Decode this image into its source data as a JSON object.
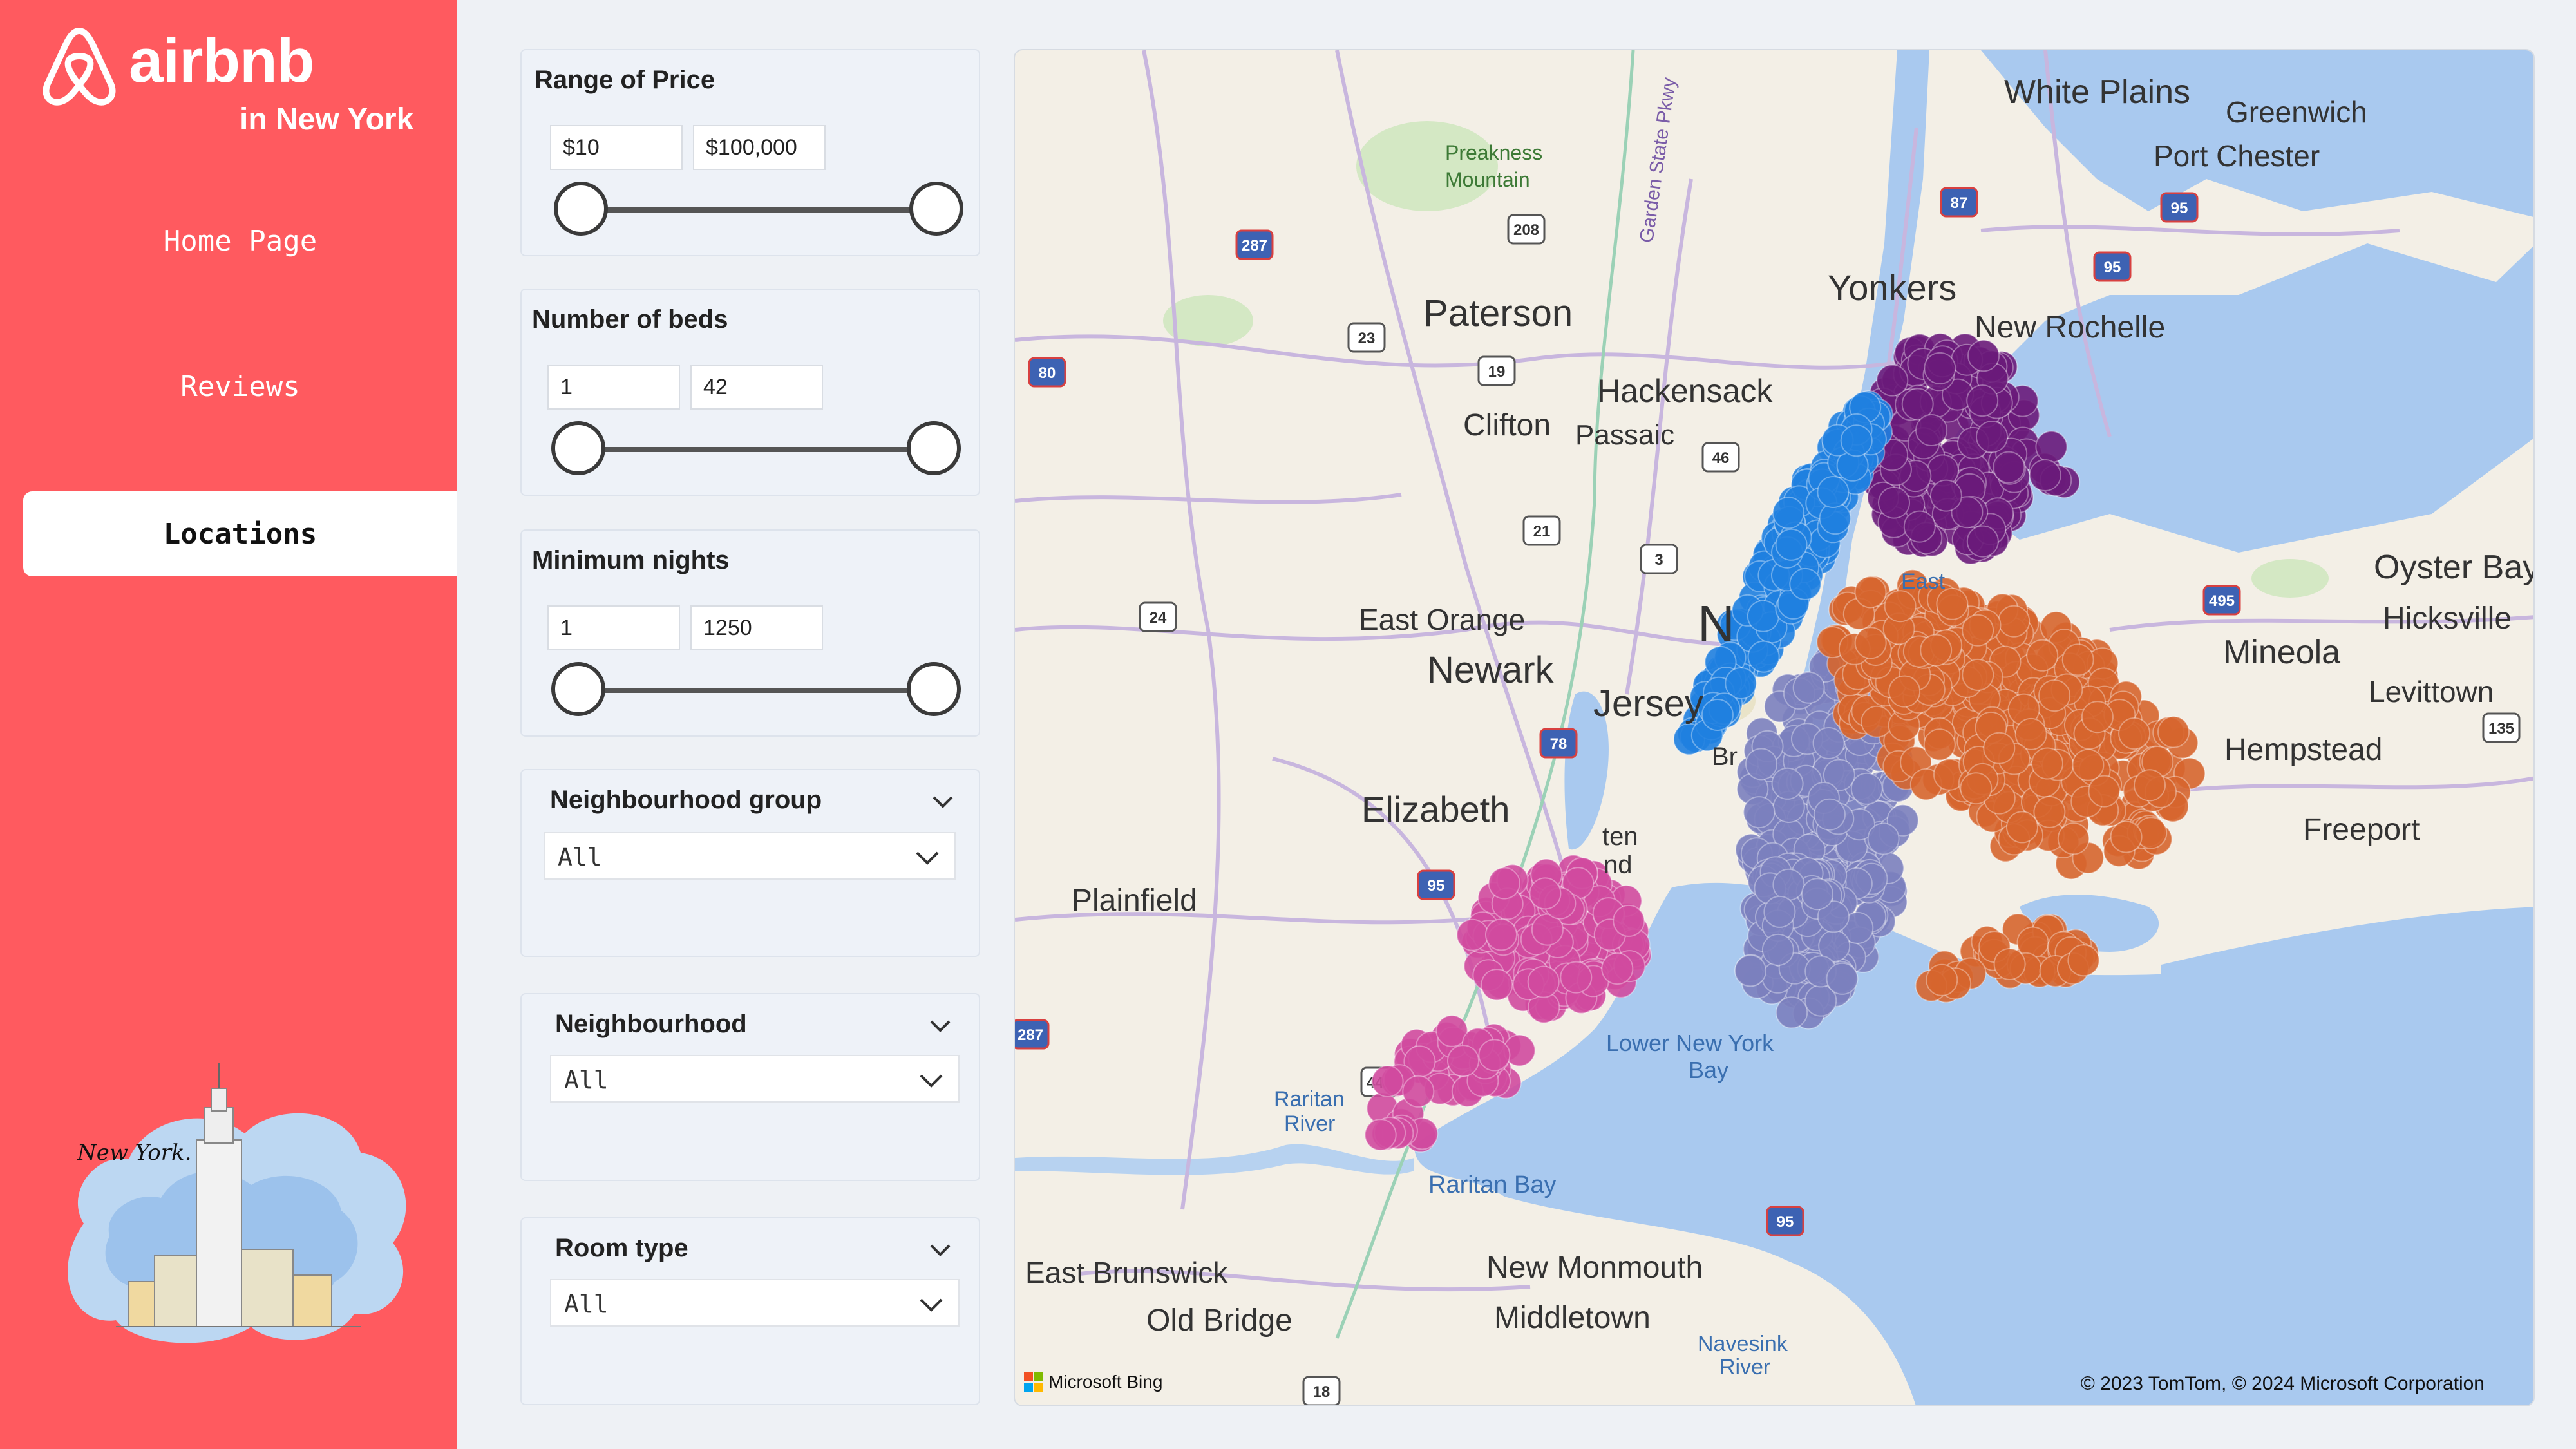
{
  "brand": {
    "name": "airbnb",
    "subtitle": "in New York",
    "illustration_caption": "New York."
  },
  "nav": {
    "items": [
      {
        "label": "Home Page"
      },
      {
        "label": "Reviews"
      },
      {
        "label": "Locations"
      }
    ],
    "active": "Locations"
  },
  "filters": {
    "price": {
      "title": "Range of Price",
      "min": "$10",
      "max": "$100,000"
    },
    "beds": {
      "title": "Number of beds",
      "min": "1",
      "max": "42"
    },
    "nights": {
      "title": "Minimum nights",
      "min": "1",
      "max": "1250"
    },
    "neighbourhood_group": {
      "title": "Neighbourhood group",
      "value": "All"
    },
    "neighbourhood": {
      "title": "Neighbourhood",
      "value": "All"
    },
    "room_type": {
      "title": "Room type",
      "value": "All"
    }
  },
  "map": {
    "labels": {
      "white_plains": "White Plains",
      "greenwich": "Greenwich",
      "port_chester": "Port Chester",
      "preakness": "Preakness",
      "mountain": "Mountain",
      "yonkers": "Yonkers",
      "new_rochelle": "New Rochelle",
      "paterson": "Paterson",
      "hackensack": "Hackensack",
      "clifton": "Clifton",
      "passaic": "Passaic",
      "oyster_bay": "Oyster Bay",
      "hicksville": "Hicksville",
      "mineola": "Mineola",
      "levittown": "Levittown",
      "east_orange": "East Orange",
      "newark": "Newark",
      "jersey": "Jersey",
      "hempstead": "Hempstead",
      "freeport": "Freeport",
      "elizabeth": "Elizabeth",
      "plainfield": "Plainfield",
      "lower_ny_bay_1": "Lower New York",
      "lower_ny_bay_2": "Bay",
      "raritan_river_1": "Raritan",
      "raritan_river_2": "River",
      "raritan_bay": "Raritan Bay",
      "east_brunswick": "East Brunswick",
      "new_monmouth": "New Monmouth",
      "old_bridge": "Old Bridge",
      "middletown": "Middletown",
      "navesink_1": "Navesink",
      "navesink_2": "River",
      "staten_1": "ten",
      "staten_2": "nd",
      "br": "Br",
      "n_partial": "N",
      "east_partial": "East",
      "garden_state_pkwy": "Garden State Pkwy"
    },
    "shields": [
      "287",
      "208",
      "87",
      "95",
      "95",
      "80",
      "23",
      "19",
      "46",
      "21",
      "3",
      "24",
      "495",
      "78",
      "135",
      "95",
      "287",
      "440",
      "95",
      "18"
    ],
    "attribution": "© 2023 TomTom, © 2024 Microsoft Corporation",
    "provider": "Microsoft Bing",
    "colors": {
      "manhattan": "#1f7fe0",
      "bronx": "#6a1b7a",
      "queens": "#d6652e",
      "brooklyn": "#7b7fbe",
      "staten_island": "#d04a9f",
      "water": "#a9c9ef",
      "land": "#f3efe6"
    }
  }
}
